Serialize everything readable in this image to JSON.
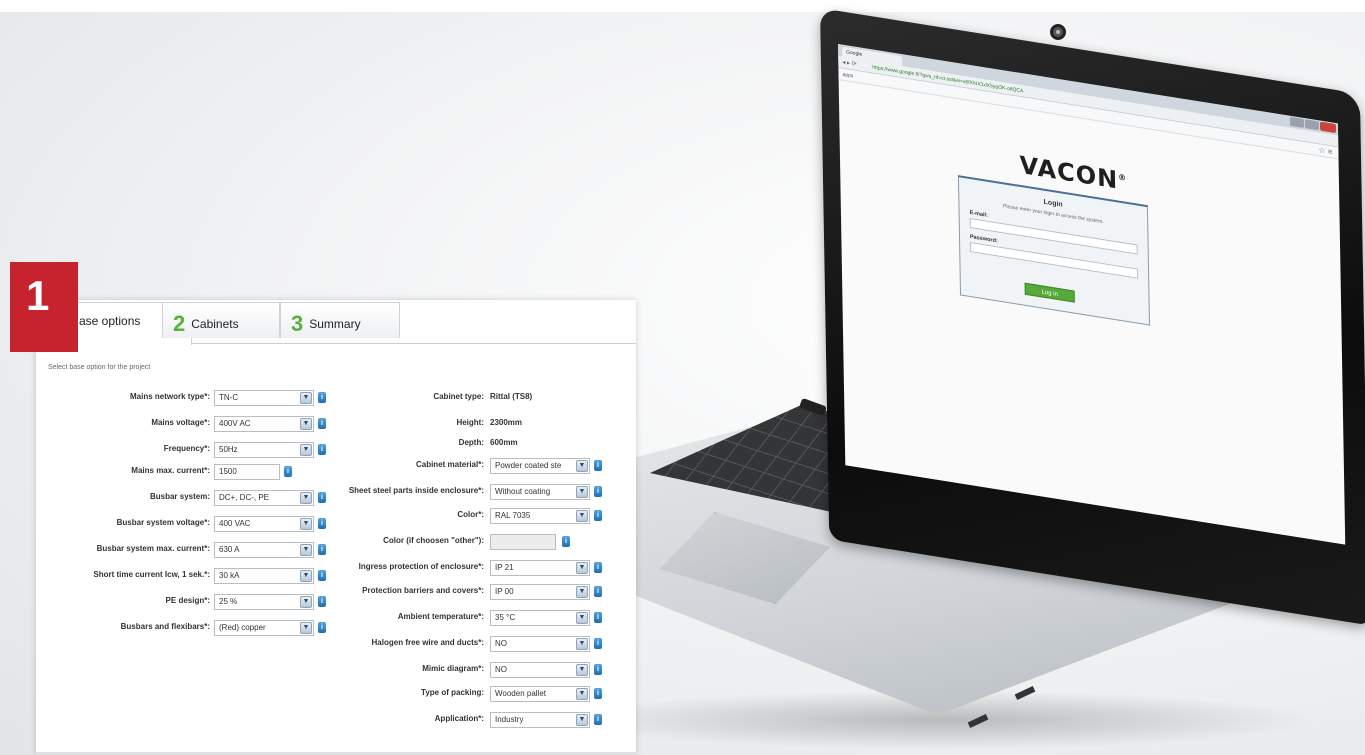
{
  "laptop_screen": {
    "browser_tab": "Google",
    "url": "https://www.google.fi/?gws_rd=cr,ssl&ei=x6fXhUOxlX5ygOK-o8QCA",
    "logo": "VACON",
    "login": {
      "title": "Login",
      "description": "Please enter your login to access the system.",
      "email_label": "E-mail:",
      "password_label": "Password:",
      "button": "Log in"
    }
  },
  "tabs": [
    {
      "number": "1",
      "label": "Base options"
    },
    {
      "number": "2",
      "label": "Cabinets"
    },
    {
      "number": "3",
      "label": "Summary"
    }
  ],
  "tab1_visible_label": "ase options",
  "form": {
    "subtitle": "Select base option for the project",
    "left": [
      {
        "label": "Mains network type*:",
        "value": "TN-C"
      },
      {
        "label": "Mains voltage*:",
        "value": "400V AC"
      },
      {
        "label": "Frequency*:",
        "value": "50Hz"
      },
      {
        "label": "Mains max. current*:",
        "value": "1500"
      },
      {
        "label": "Busbar system:",
        "value": "DC+, DC-, PE"
      },
      {
        "label": "Busbar system voltage*:",
        "value": "400 VAC"
      },
      {
        "label": "Busbar system max. current*:",
        "value": "630 A"
      },
      {
        "label": "Short time current Icw, 1 sek.*:",
        "value": "30 kA"
      },
      {
        "label": "PE design*:",
        "value": "25 %"
      },
      {
        "label": "Busbars and flexibars*:",
        "value": "(Red) copper"
      }
    ],
    "right_static": [
      {
        "label": "Cabinet type:",
        "value": "Rittal (TS8)"
      },
      {
        "label": "Height:",
        "value": "2300mm"
      },
      {
        "label": "Depth:",
        "value": "600mm"
      }
    ],
    "right": [
      {
        "label": "Cabinet material*:",
        "value": "Powder coated ste"
      },
      {
        "label": "Sheet steel parts inside enclosure*:",
        "value": "Without coating"
      },
      {
        "label": "Color*:",
        "value": "RAL 7035"
      },
      {
        "label": "Color (if choosen \"other\"):",
        "value": ""
      },
      {
        "label": "Ingress protection of enclosure*:",
        "value": "IP 21"
      },
      {
        "label": "Protection barriers and covers*:",
        "value": "IP 00"
      },
      {
        "label": "Ambient temperature*:",
        "value": "35 °C"
      },
      {
        "label": "Halogen free wire and ducts*:",
        "value": "NO"
      },
      {
        "label": "Mimic diagram*:",
        "value": "NO"
      },
      {
        "label": "Type of packing:",
        "value": "Wooden pallet"
      },
      {
        "label": "Application*:",
        "value": "Industry"
      }
    ]
  },
  "icons": {
    "info": "i",
    "dropdown": "▼"
  },
  "colors": {
    "badge_red": "#c7232f",
    "step_green": "#57b23a",
    "info_blue": "#1f6fb5"
  }
}
